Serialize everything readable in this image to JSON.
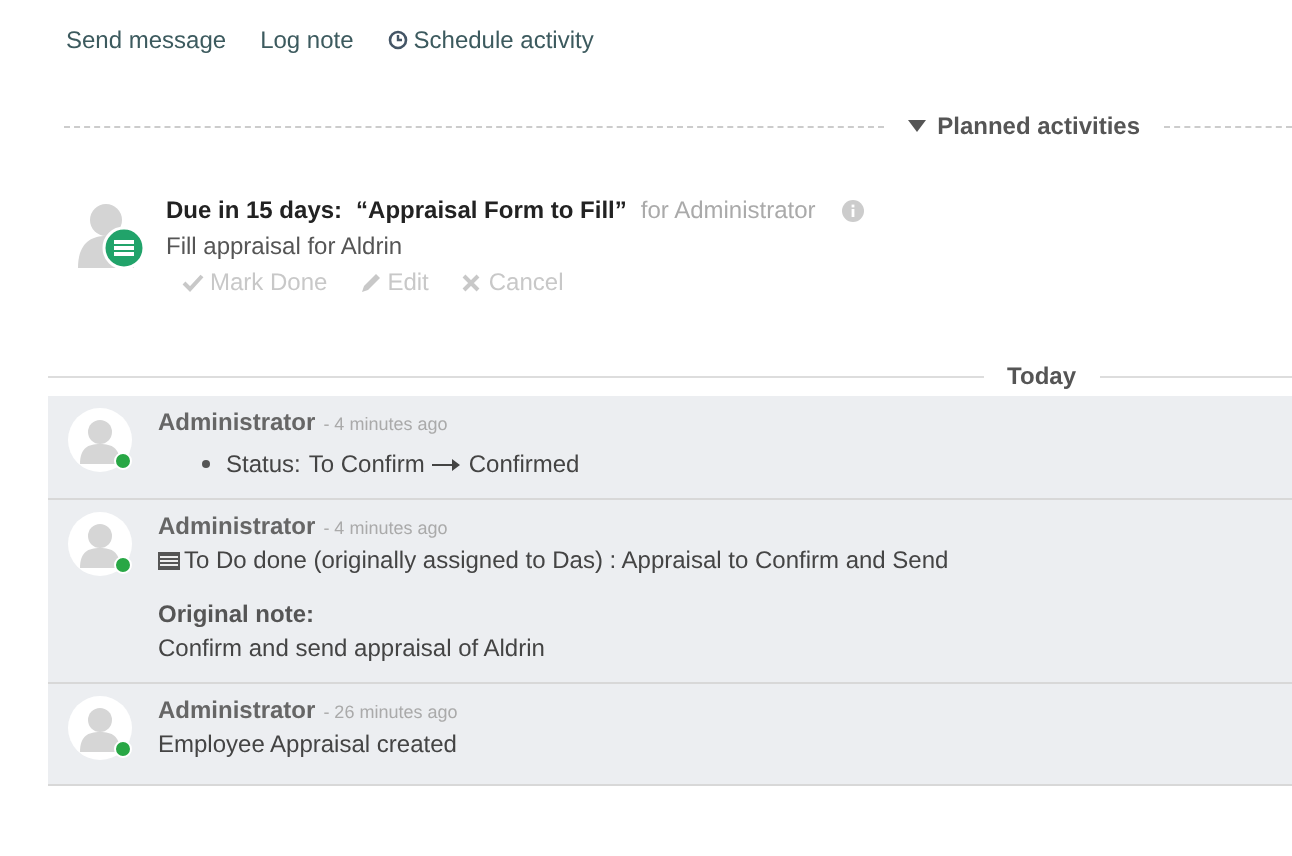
{
  "chatter_actions": [
    {
      "kind": "plain",
      "label": "Send message"
    },
    {
      "kind": "plain",
      "label": "Log note"
    },
    {
      "kind": "clock",
      "label": "Schedule activity"
    }
  ],
  "planned_section": {
    "label": "Planned activities",
    "expanded": true
  },
  "activities": [
    {
      "due": "Due in 15 days:",
      "title": "“Appraisal Form to Fill”",
      "assignee": "for Administrator",
      "note": "Fill appraisal for Aldrin",
      "actions": [
        {
          "kind": "check",
          "label": "Mark Done"
        },
        {
          "kind": "pencil",
          "label": "Edit"
        },
        {
          "kind": "times",
          "label": "Cancel"
        }
      ]
    }
  ],
  "date_separator": "Today",
  "messages": [
    {
      "kind": "tracking",
      "author": "Administrator",
      "time": "- 4 minutes ago",
      "online": true,
      "changes": [
        {
          "field": "Status:",
          "old": "To Confirm",
          "new": "Confirmed"
        }
      ]
    },
    {
      "kind": "activity_done",
      "author": "Administrator",
      "time": "- 4 minutes ago",
      "online": true,
      "text": "To Do done (originally assigned to Das) : Appraisal to Confirm and Send",
      "note_label": "Original note:",
      "note": "Confirm and send appraisal of Aldrin"
    },
    {
      "kind": "text",
      "author": "Administrator",
      "time": "- 26 minutes ago",
      "online": true,
      "text": "Employee Appraisal created"
    }
  ]
}
